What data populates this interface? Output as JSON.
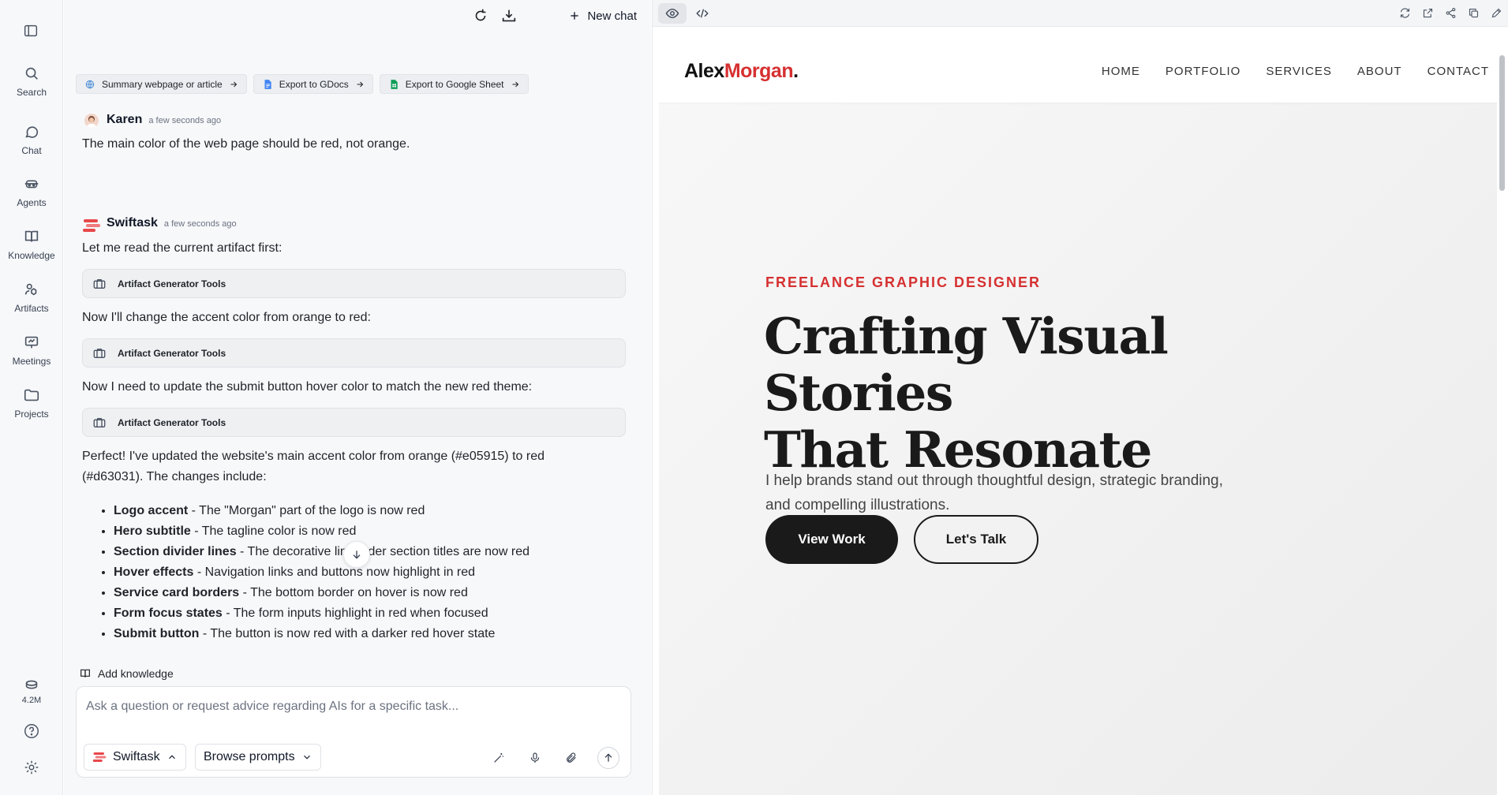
{
  "rail": {
    "items": [
      {
        "label": "Search",
        "icon": "search-icon"
      },
      {
        "label": "Chat",
        "icon": "chat-icon"
      },
      {
        "label": "Agents",
        "icon": "agents-icon"
      },
      {
        "label": "Knowledge",
        "icon": "book-icon"
      },
      {
        "label": "Artifacts",
        "icon": "artifacts-icon"
      },
      {
        "label": "Meetings",
        "icon": "meetings-icon"
      },
      {
        "label": "Projects",
        "icon": "folder-icon"
      }
    ],
    "credits": "4.2M"
  },
  "chat": {
    "new_chat_label": "New chat",
    "quick_actions": [
      {
        "label": "Summary webpage or article",
        "icon": "globe-icon"
      },
      {
        "label": "Export to GDocs",
        "icon": "gdocs-icon"
      },
      {
        "label": "Export to Google Sheet",
        "icon": "gsheet-icon"
      }
    ],
    "user_message": {
      "name": "Karen",
      "time": "a few seconds ago",
      "text": "The main color of the web page should be red, not orange."
    },
    "assistant": {
      "name": "Swiftask",
      "time": "a few seconds ago",
      "line1": "Let me read the current artifact first:",
      "tool_label": "Artifact Generator Tools",
      "line2": "Now I'll change the accent color from orange to red:",
      "line3": "Now I need to update the submit button hover color to match the new red theme:",
      "summary_1": "Perfect! I've updated the website's main accent color from orange (#e05915) to red",
      "summary_2": "(#d63031). The changes include:",
      "bullets": [
        {
          "bold": "Logo accent",
          "rest": " - The \"Morgan\" part of the logo is now red"
        },
        {
          "bold": "Hero subtitle",
          "rest": " - The tagline color is now red"
        },
        {
          "bold": "Section divider lines",
          "rest": " - The decorative lin      der section titles are now red"
        },
        {
          "bold": "Hover effects",
          "rest": " - Navigation links and buttons now highlight in red"
        },
        {
          "bold": "Service card borders",
          "rest": " - The bottom border on hover is now red"
        },
        {
          "bold": "Form focus states",
          "rest": " - The form inputs highlight in red when focused"
        },
        {
          "bold": "Submit button",
          "rest": " - The button is now red with a darker red hover state"
        }
      ]
    },
    "add_knowledge": "Add knowledge",
    "composer_placeholder": "Ask a question or request advice regarding AIs for a specific task...",
    "agent_select": "Swiftask",
    "prompts_select": "Browse prompts"
  },
  "preview": {
    "site": {
      "logo_main": "Alex",
      "logo_accent": "Morgan",
      "logo_dot": ".",
      "nav": [
        "HOME",
        "PORTFOLIO",
        "SERVICES",
        "ABOUT",
        "CONTACT"
      ],
      "hero_tag": "FREELANCE GRAPHIC DESIGNER",
      "hero_title_1": "Crafting Visual Stories",
      "hero_title_2": "That Resonate",
      "hero_sub": "I help brands stand out through thoughtful design, strategic branding, and compelling illustrations.",
      "btn_primary": "View Work",
      "btn_secondary": "Let's Talk"
    },
    "colors": {
      "accent": "#d63031",
      "dark": "#1a1a1a"
    }
  }
}
